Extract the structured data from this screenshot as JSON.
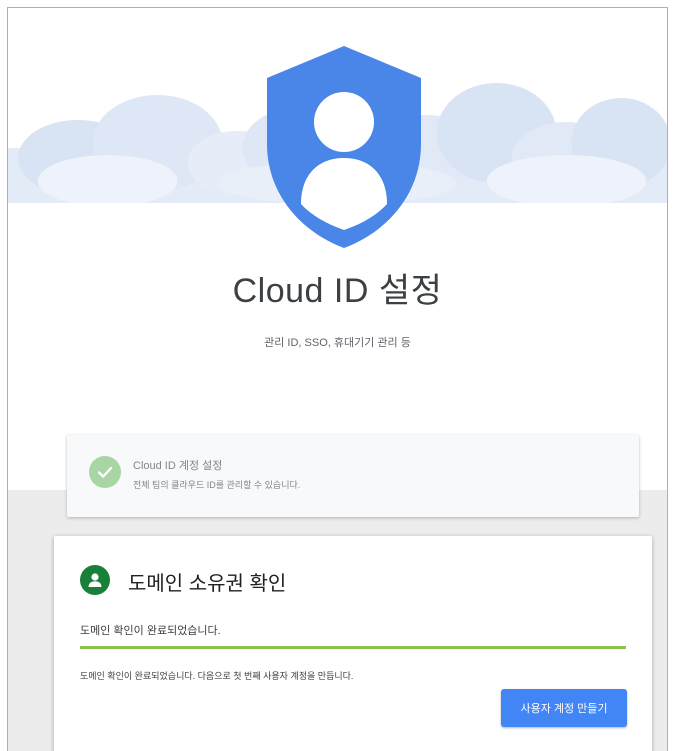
{
  "hero": {
    "title": "Cloud ID 설정",
    "subtitle": "관리 ID, SSO, 휴대기기 관리 등",
    "icon": "shield-person-icon",
    "accent_color": "#4a86e8",
    "cloud_color": "#e3ebf7"
  },
  "completed_step": {
    "title": "Cloud ID 계정 설정",
    "description": "전체 팀의 클라우드 ID를 관리할 수 있습니다.",
    "icon": "check-circle-icon",
    "status_color": "#a8d5a4"
  },
  "domain_card": {
    "icon": "person-circle-icon",
    "title": "도메인 소유권 확인",
    "status": "도메인 확인이 완료되었습니다.",
    "progress": 1.0,
    "progress_color": "#8bc34a",
    "info": "도메인 확인이 완료되었습니다. 다음으로 첫 번째 사용자 계정을 만듭니다.",
    "button_label": "사용자 계정 만들기",
    "button_color": "#4285f4"
  }
}
